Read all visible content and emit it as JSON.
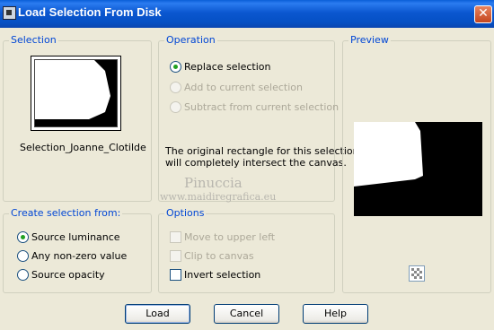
{
  "window": {
    "title": "Load Selection From Disk",
    "close_glyph": "✕"
  },
  "selection": {
    "legend": "Selection",
    "name": "Selection_Joanne_Clotilde"
  },
  "operation": {
    "legend": "Operation",
    "options": [
      {
        "label": "Replace selection",
        "checked": true,
        "enabled": true
      },
      {
        "label": "Add to current selection",
        "checked": false,
        "enabled": false
      },
      {
        "label": "Subtract from current selection",
        "checked": false,
        "enabled": false
      }
    ],
    "message_line1": "The original rectangle for this selection",
    "message_line2": "will completely intersect the canvas."
  },
  "preview": {
    "legend": "Preview",
    "icon": "checkerboard-icon"
  },
  "watermark": {
    "name": "Pinuccia",
    "site": "www.maidiregrafica.eu"
  },
  "create_from": {
    "legend": "Create selection from:",
    "options": [
      {
        "label": "Source luminance",
        "checked": true
      },
      {
        "label": "Any non-zero value",
        "checked": false
      },
      {
        "label": "Source opacity",
        "checked": false
      }
    ]
  },
  "options": {
    "legend": "Options",
    "items": [
      {
        "label": "Move to upper left",
        "checked": false,
        "enabled": false
      },
      {
        "label": "Clip to canvas",
        "checked": false,
        "enabled": false
      },
      {
        "label": "Invert selection",
        "checked": false,
        "enabled": true
      }
    ]
  },
  "buttons": {
    "load": "Load",
    "cancel": "Cancel",
    "help": "Help"
  },
  "colors": {
    "title_bar": "#0b57d0",
    "dialog_bg": "#ece9d8",
    "legend_text": "#0046d5",
    "radio_dot": "#21a121"
  }
}
